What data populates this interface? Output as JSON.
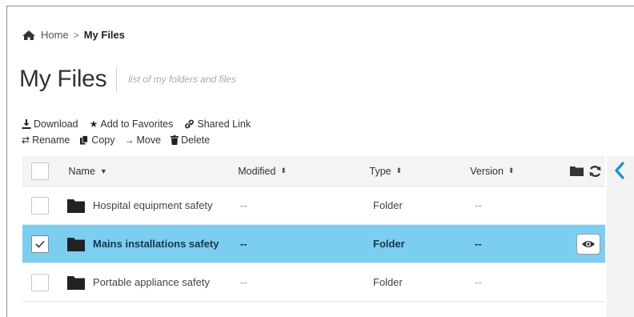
{
  "breadcrumb": {
    "home": "Home",
    "separator": ">",
    "current": "My Files"
  },
  "page": {
    "title": "My Files",
    "subtitle": "list of my folders and files"
  },
  "actions": {
    "row1": [
      {
        "label": "Download",
        "icon": "download-icon"
      },
      {
        "label": "Add to Favorites",
        "icon": "star-icon"
      },
      {
        "label": "Shared Link",
        "icon": "link-icon"
      }
    ],
    "row2": [
      {
        "label": "Rename",
        "icon": "rename-arrows-icon"
      },
      {
        "label": "Copy",
        "icon": "copy-icon"
      },
      {
        "label": "Move",
        "icon": "arrow-right-icon"
      },
      {
        "label": "Delete",
        "icon": "trash-icon"
      }
    ]
  },
  "table": {
    "columns": {
      "name": "Name",
      "modified": "Modified",
      "type": "Type",
      "version": "Version"
    },
    "rows": [
      {
        "name": "Hospital equipment safety",
        "modified": "--",
        "type": "Folder",
        "version": "--",
        "selected": false
      },
      {
        "name": "Mains installations safety",
        "modified": "--",
        "type": "Folder",
        "version": "--",
        "selected": true
      },
      {
        "name": "Portable appliance safety",
        "modified": "--",
        "type": "Folder",
        "version": "--",
        "selected": false
      }
    ]
  },
  "colors": {
    "selected_row": "#7ccef0",
    "accent": "#1a8fd6",
    "header_bg": "#f4f4f4"
  }
}
